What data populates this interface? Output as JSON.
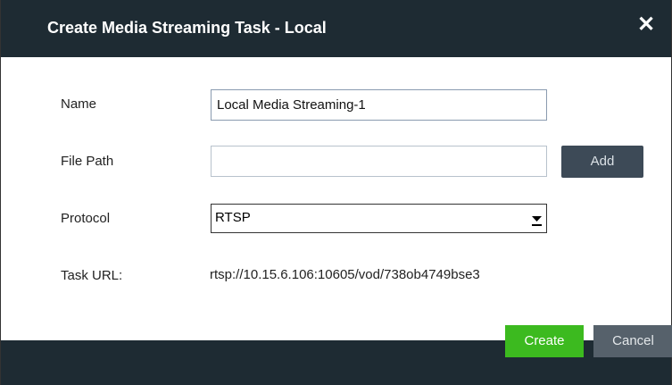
{
  "dialog": {
    "title": "Create Media Streaming Task - Local",
    "close_icon": "close-icon"
  },
  "form": {
    "name": {
      "label": "Name",
      "value": "Local Media Streaming-1"
    },
    "file_path": {
      "label": "File Path",
      "value": "",
      "add_label": "Add"
    },
    "protocol": {
      "label": "Protocol",
      "selected": "RTSP",
      "arrow_icon": "chevron-down-icon"
    },
    "task_url": {
      "label": "Task URL:",
      "value": "rtsp://10.15.6.106:10605/vod/738ob4749bse3"
    }
  },
  "footer": {
    "create_label": "Create",
    "cancel_label": "Cancel"
  },
  "colors": {
    "titlebar": "#1e2b33",
    "create": "#3cba1f",
    "cancel": "#56616b",
    "add": "#3d4a57"
  }
}
